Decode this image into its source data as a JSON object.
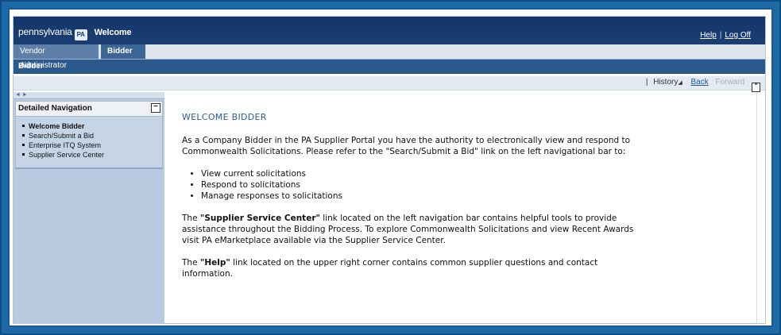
{
  "header": {
    "brand_name": "pennsylvania",
    "logo_text": "PA",
    "welcome": "Welcome",
    "help_link": "Help",
    "logoff_link": "Log Off"
  },
  "tabs": [
    {
      "label": "Vendor Administrator",
      "active": false
    },
    {
      "label": "Bidder",
      "active": true
    }
  ],
  "subheader": {
    "title": "Bidder"
  },
  "toolbar": {
    "separator": "|",
    "history": "History",
    "back": "Back",
    "forward": "Forward"
  },
  "leftnav": {
    "header": "Detailed Navigation",
    "collapse_symbol": "—",
    "resizer_glyphs": "◄ ►",
    "items": [
      {
        "label": "Welcome Bidder",
        "current": true
      },
      {
        "label": "Search/Submit a Bid",
        "current": false
      },
      {
        "label": "Enterprise ITQ System",
        "current": false
      },
      {
        "label": "Supplier Service Center",
        "current": false
      }
    ]
  },
  "content": {
    "heading": "WELCOME BIDDER",
    "intro": "As a Company Bidder in the PA Supplier Portal you have the authority to electronically view and respond to Commonwealth Solicitations.  Please refer to the \"Search/Submit a Bid\" link on the left navigational bar to:",
    "bullets": [
      "View current solicitations",
      "Respond to solicitations",
      "Manage responses to solicitations"
    ],
    "ssc_prefix": "The ",
    "ssc_bold": "\"Supplier Service Center\"",
    "ssc_rest": " link located on the left navigation bar contains helpful tools to provide assistance throughout the Bidding Process.  To explore Commonwealth Solicitations and view Recent Awards visit PA eMarketplace available via the Supplier Service Center.",
    "help_prefix": "The ",
    "help_bold": "\"Help\"",
    "help_rest": " link located on the upper right corner contains common supplier questions and contact information."
  }
}
